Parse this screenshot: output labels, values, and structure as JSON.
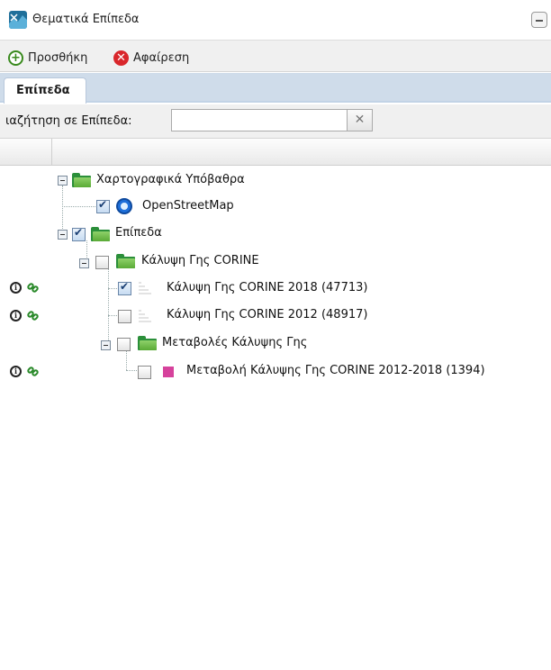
{
  "panel": {
    "title": "Θεματικά Επίπεδα"
  },
  "toolbar": {
    "add_label": "Προσθήκη",
    "remove_label": "Αφαίρεση"
  },
  "tabs": [
    {
      "label": "Επίπεδα"
    }
  ],
  "search": {
    "label": "ιαζήτηση σε Επίπεδα:",
    "value": "",
    "placeholder": ""
  },
  "tree": {
    "basemaps": {
      "label": "Χαρτογραφικά Υπόβαθρα",
      "expanded": true
    },
    "osm": {
      "label": "OpenStreetMap",
      "checked": true
    },
    "layers": {
      "label": "Επίπεδα",
      "checked": true,
      "expanded": true
    },
    "corine": {
      "label": "Κάλυψη Γης CORINE",
      "checked": false,
      "expanded": true
    },
    "corine2018": {
      "label": "Κάλυψη Γης CORINE 2018 (47713)",
      "checked": true
    },
    "corine2012": {
      "label": "Κάλυψη Γης CORINE 2012 (48917)",
      "checked": false
    },
    "changes": {
      "label": "Μεταβολές Κάλυψης Γης",
      "checked": false,
      "expanded": true
    },
    "change1218": {
      "label": "Μεταβολή Κάλυψης Γης CORINE 2012-2018 (1394)",
      "checked": false,
      "legend_color": "#d6429c"
    }
  }
}
